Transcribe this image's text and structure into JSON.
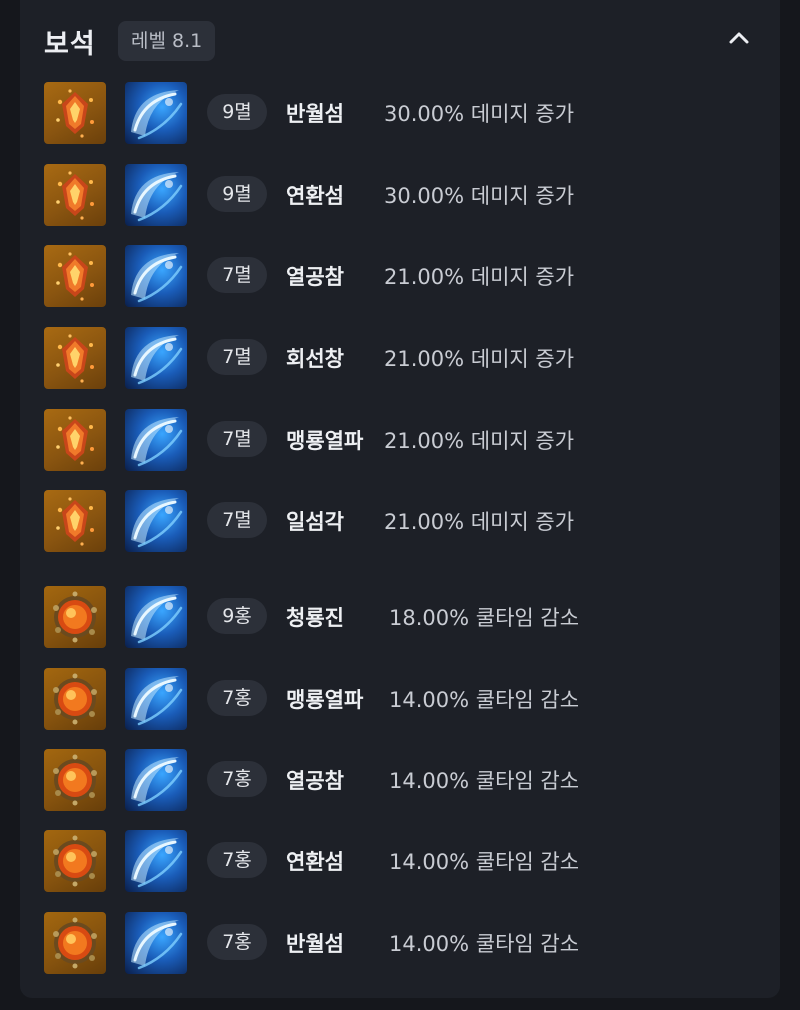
{
  "header": {
    "title": "보석",
    "level": "레벨 8.1"
  },
  "gems": [
    {
      "tier": "9멸",
      "skill": "반월섬",
      "effect": "30.00% 데미지 증가",
      "type": "dmg"
    },
    {
      "tier": "9멸",
      "skill": "연환섬",
      "effect": "30.00% 데미지 증가",
      "type": "dmg"
    },
    {
      "tier": "7멸",
      "skill": "열공참",
      "effect": "21.00% 데미지 증가",
      "type": "dmg"
    },
    {
      "tier": "7멸",
      "skill": "회선창",
      "effect": "21.00% 데미지 증가",
      "type": "dmg"
    },
    {
      "tier": "7멸",
      "skill": "맹룡열파",
      "effect": "21.00% 데미지 증가",
      "type": "dmg"
    },
    {
      "tier": "7멸",
      "skill": "일섬각",
      "effect": "21.00% 데미지 증가",
      "type": "dmg"
    },
    {
      "tier": "9홍",
      "skill": "청룡진",
      "effect": "18.00% 쿨타임 감소",
      "type": "cd"
    },
    {
      "tier": "7홍",
      "skill": "맹룡열파",
      "effect": "14.00% 쿨타임 감소",
      "type": "cd"
    },
    {
      "tier": "7홍",
      "skill": "열공참",
      "effect": "14.00% 쿨타임 감소",
      "type": "cd"
    },
    {
      "tier": "7홍",
      "skill": "연환섬",
      "effect": "14.00% 쿨타임 감소",
      "type": "cd"
    },
    {
      "tier": "7홍",
      "skill": "반월섬",
      "effect": "14.00% 쿨타임 감소",
      "type": "cd"
    }
  ],
  "icons": {
    "collapse": "chevron-up-icon",
    "damage_gem": "annihilation-gem-icon",
    "cooldown_gem": "crimson-flame-gem-icon"
  },
  "colors": {
    "panel_bg": "#1d2027",
    "badge_bg": "#2c3039",
    "gem_bg": "#9a6010",
    "skill_blue": "#3aa6ff"
  }
}
